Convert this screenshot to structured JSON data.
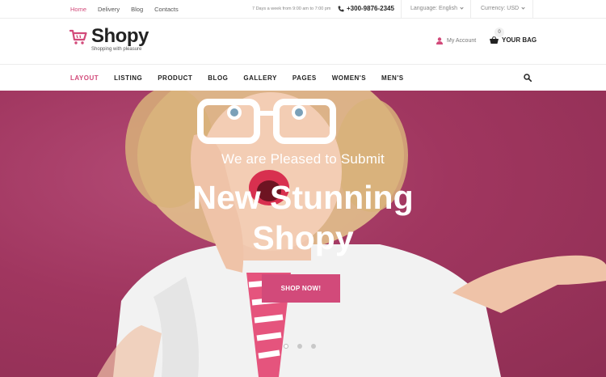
{
  "topbar": {
    "links": [
      "Home",
      "Delivery",
      "Blog",
      "Contacts"
    ],
    "hours": "7 Days a week from 9:00 am to 7:00 pm",
    "phone": "+300-9876-2345",
    "language": "Language: English",
    "currency": "Currency: USD"
  },
  "header": {
    "brand": "Shopy",
    "tagline": "Shopping with pleasure",
    "account": "My Account",
    "bag_label": "YOUR BAG",
    "bag_count": "0"
  },
  "nav": {
    "items": [
      "LAYOUT",
      "LISTING",
      "PRODUCT",
      "BLOG",
      "GALLERY",
      "PAGES",
      "WOMEN'S",
      "MEN'S"
    ]
  },
  "hero": {
    "subtitle": "We are Pleased to Submit",
    "title_line1": "New Stunning",
    "title_line2": "Shopy",
    "cta": "SHOP NOW!",
    "slides_total": 3,
    "active_slide": 1
  },
  "colors": {
    "accent": "#d24a7a",
    "hero_bg": "#a0365f"
  },
  "icons": [
    "phone-icon",
    "cart-logo-icon",
    "user-icon",
    "basket-icon",
    "search-icon",
    "chevron-down-icon"
  ]
}
